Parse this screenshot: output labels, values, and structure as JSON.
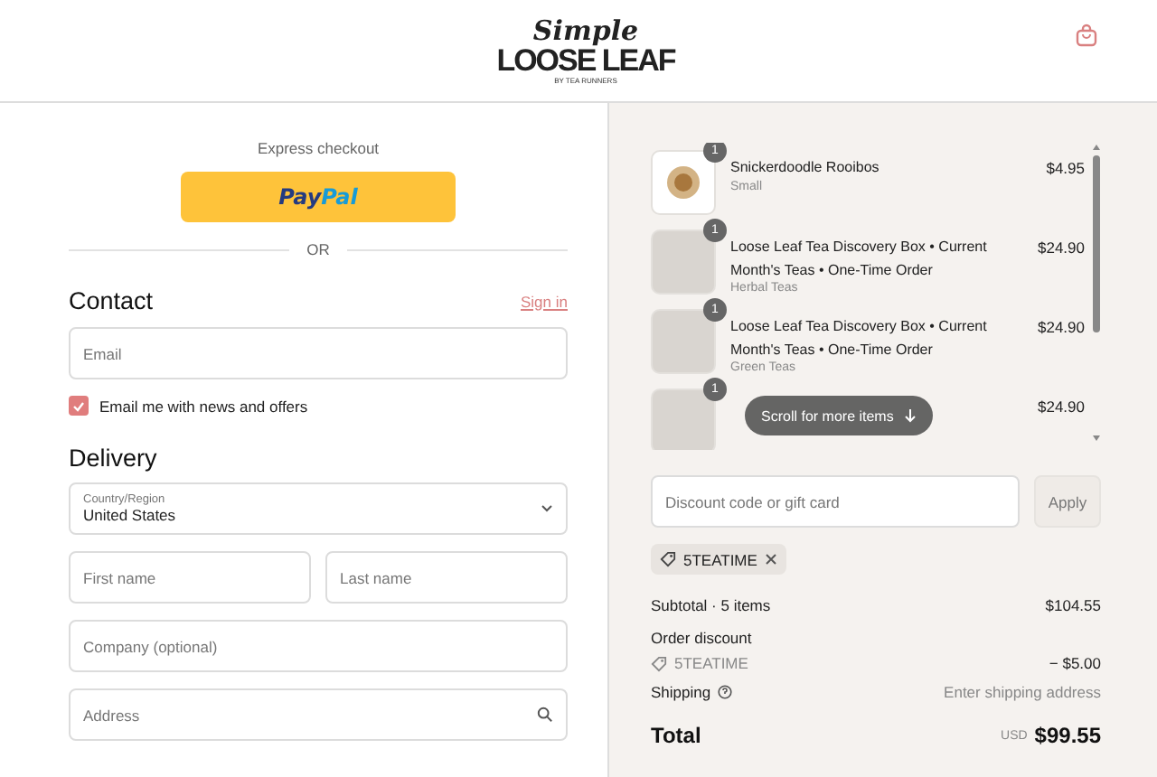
{
  "header": {
    "logo": {
      "script": "Simple",
      "main": "LOOSE LEAF",
      "tagline": "BY TEA RUNNERS"
    }
  },
  "express": {
    "label": "Express checkout",
    "paypal": {
      "part_1": "Pay",
      "part_2": "Pal"
    },
    "divider": "OR"
  },
  "contact": {
    "title": "Contact",
    "sign_in": "Sign in",
    "email": {
      "placeholder": "Email"
    },
    "newsletter": {
      "label": "Email me with news and offers",
      "checked": true
    }
  },
  "delivery": {
    "title": "Delivery",
    "country": {
      "label": "Country/Region",
      "value": "United States"
    },
    "fields": [
      {
        "placeholder": "First name",
        "kind": "half"
      },
      {
        "placeholder": "Last name",
        "kind": "half"
      },
      {
        "placeholder": "Company (optional)",
        "kind": "full"
      },
      {
        "placeholder": "Address",
        "kind": "search"
      }
    ]
  },
  "cart": {
    "items": [
      {
        "quantity": "1",
        "name": "Snickerdoodle Rooibos",
        "variant": "Small",
        "price": "$4.95",
        "kind": "loose"
      },
      {
        "quantity": "1",
        "name": "Loose Leaf Tea Discovery Box • Current Month's Teas • One-Time Order",
        "variant": "Herbal Teas",
        "price": "$24.90",
        "kind": "box"
      },
      {
        "quantity": "1",
        "name": "Loose Leaf Tea Discovery Box • Current Month's Teas • One-Time Order",
        "variant": "Green Teas",
        "price": "$24.90",
        "kind": "box"
      },
      {
        "quantity": "1",
        "price": "$24.90",
        "kind": "box"
      }
    ],
    "scroll_hint": "Scroll for more items",
    "discount": {
      "placeholder": "Discount code or gift card",
      "button": "Apply"
    },
    "applied_code": "5TEATIME",
    "subtotal": {
      "label": "Subtotal · 5 items",
      "value": "$104.55"
    },
    "order_discount": {
      "label": "Order discount",
      "code": "5TEATIME",
      "value": "− $5.00"
    },
    "shipping": {
      "label": "Shipping",
      "value": "Enter shipping address"
    },
    "total": {
      "label": "Total",
      "currency": "USD",
      "value": "$99.55"
    }
  }
}
